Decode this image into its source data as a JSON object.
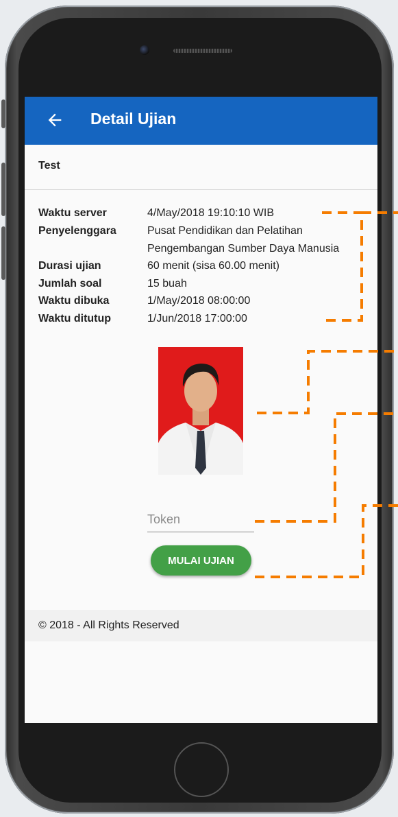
{
  "appbar": {
    "title": "Detail Ujian"
  },
  "exam_name": "Test",
  "details": [
    {
      "label": "Waktu server",
      "value": "4/May/2018 19:10:10 WIB"
    },
    {
      "label": "Penyelenggara",
      "value": "Pusat Pendidikan dan Pelatihan"
    },
    {
      "label": "",
      "value": "Pengembangan Sumber Daya Manusia"
    },
    {
      "label": "Durasi ujian",
      "value": "60 menit (sisa 60.00 menit)"
    },
    {
      "label": "Jumlah soal",
      "value": "15 buah"
    },
    {
      "label": "Waktu dibuka",
      "value": "1/May/2018 08:00:00"
    },
    {
      "label": "Waktu ditutup",
      "value": "1/Jun/2018 17:00:00"
    }
  ],
  "token": {
    "placeholder": "Token",
    "value": ""
  },
  "start_button": {
    "label": "MULAI UJIAN"
  },
  "footer": {
    "text": "© 2018 - All Rights Reserved"
  },
  "colors": {
    "appbar": "#1565c0",
    "button": "#43a047",
    "annotation": "#f57c00",
    "photo_bg": "#e01b1b"
  },
  "icons": {
    "back": "arrow-left-icon"
  }
}
